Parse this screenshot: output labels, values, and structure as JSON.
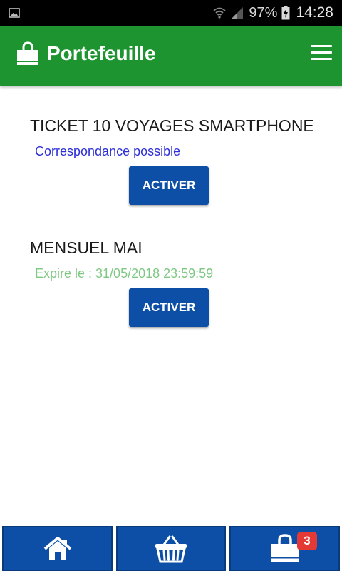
{
  "status_bar": {
    "battery_percent": "97%",
    "time": "14:28"
  },
  "toolbar": {
    "title": "Portefeuille",
    "icon": "shopping-bag-icon",
    "menu_icon": "hamburger-menu-icon"
  },
  "tickets": [
    {
      "title": "TICKET 10 VOYAGES SMARTPHONE",
      "subtitle": "Correspondance possible",
      "subtitle_color": "#2d2fd6",
      "button_label": "ACTIVER"
    },
    {
      "title": "MENSUEL MAI",
      "subtitle": "Expire le : 31/05/2018 23:59:59",
      "subtitle_color": "#7fc884",
      "button_label": "ACTIVER"
    }
  ],
  "bottom_nav": {
    "items": [
      {
        "icon": "home-icon"
      },
      {
        "icon": "basket-icon"
      },
      {
        "icon": "shopping-bag-icon",
        "badge": "3"
      }
    ]
  },
  "colors": {
    "primary_green": "#1e9431",
    "button_blue": "#0d4fa6",
    "badge_red": "#e53935"
  }
}
